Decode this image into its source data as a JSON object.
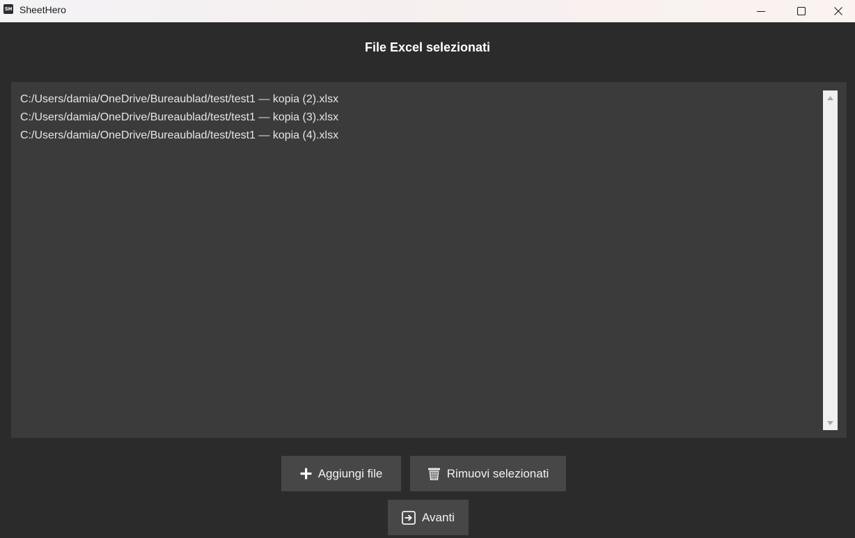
{
  "window": {
    "app_icon_text": "SH",
    "title": "SheetHero",
    "controls": [
      "minimize",
      "maximize",
      "close"
    ]
  },
  "main": {
    "heading": "File Excel selezionati",
    "files": [
      "C:/Users/damia/OneDrive/Bureaublad/test/test1 — kopia (2).xlsx",
      "C:/Users/damia/OneDrive/Bureaublad/test/test1 — kopia (3).xlsx",
      "C:/Users/damia/OneDrive/Bureaublad/test/test1 — kopia (4).xlsx"
    ]
  },
  "actions": {
    "add_label": "Aggiungi file",
    "add_icon": "plus-icon",
    "remove_label": "Rimuovi selezionati",
    "remove_icon": "wastebasket-icon",
    "next_label": "Avanti",
    "next_icon": "arrow-right-box-icon"
  },
  "colors": {
    "background": "#2b2b2b",
    "list_background": "#3b3b3b",
    "button_background": "#474747",
    "text": "#e6e6e6"
  }
}
